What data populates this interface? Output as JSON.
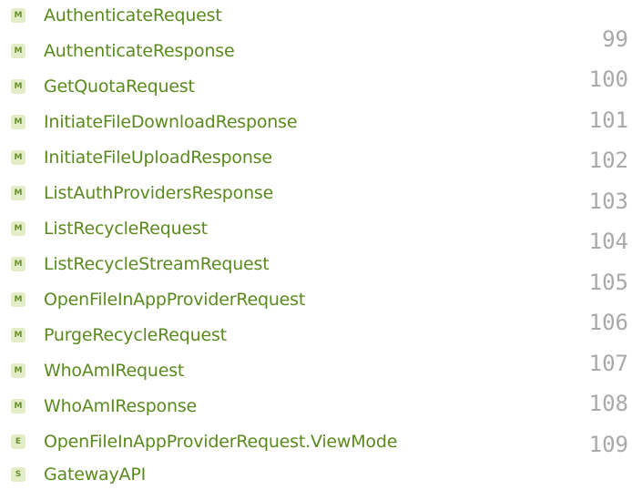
{
  "line_numbers": [
    "99",
    "100",
    "101",
    "102",
    "103",
    "104",
    "105",
    "106",
    "107",
    "108",
    "109"
  ],
  "items": [
    {
      "kind": "M",
      "label": "AuthenticateRequest"
    },
    {
      "kind": "M",
      "label": "AuthenticateResponse"
    },
    {
      "kind": "M",
      "label": "GetQuotaRequest"
    },
    {
      "kind": "M",
      "label": "InitiateFileDownloadResponse"
    },
    {
      "kind": "M",
      "label": "InitiateFileUploadResponse"
    },
    {
      "kind": "M",
      "label": "ListAuthProvidersResponse"
    },
    {
      "kind": "M",
      "label": "ListRecycleRequest"
    },
    {
      "kind": "M",
      "label": "ListRecycleStreamRequest"
    },
    {
      "kind": "M",
      "label": "OpenFileInAppProviderRequest"
    },
    {
      "kind": "M",
      "label": "PurgeRecycleRequest"
    },
    {
      "kind": "M",
      "label": "WhoAmIRequest"
    },
    {
      "kind": "M",
      "label": "WhoAmIResponse"
    },
    {
      "kind": "E",
      "label": "OpenFileInAppProviderRequest.ViewMode"
    },
    {
      "kind": "S",
      "label": "GatewayAPI"
    }
  ],
  "colors": {
    "label": "#5a8a1e",
    "badge_bg": "#e3edc8",
    "badge_fg": "#6b8f2c",
    "gutter_text": "#a9a9a9"
  }
}
